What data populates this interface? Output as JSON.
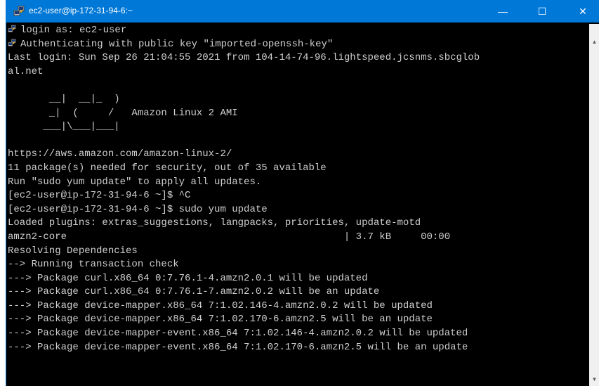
{
  "window": {
    "title": "ec2-user@ip-172-31-94-6:~",
    "minimize_glyph": "—",
    "maximize_glyph": "☐",
    "close_glyph": "✕"
  },
  "icons": {
    "title": "putty-icon",
    "prompt": "putty-icon"
  },
  "colors": {
    "titlebar": "#0078d7",
    "terminal_bg": "#000000",
    "terminal_fg": "#d0d0d0"
  },
  "terminal": {
    "lines": [
      "login as: ec2-user",
      "Authenticating with public key \"imported-openssh-key\"",
      "Last login: Sun Sep 26 21:04:55 2021 from 104-14-74-96.lightspeed.jcsnms.sbcglob",
      "al.net",
      "",
      "       __|  __|_  )",
      "       _|  (     /   Amazon Linux 2 AMI",
      "      ___|\\___|___|",
      "",
      "https://aws.amazon.com/amazon-linux-2/",
      "11 package(s) needed for security, out of 35 available",
      "Run \"sudo yum update\" to apply all updates.",
      "[ec2-user@ip-172-31-94-6 ~]$ ^C",
      "[ec2-user@ip-172-31-94-6 ~]$ sudo yum update",
      "Loaded plugins: extras_suggestions, langpacks, priorities, update-motd",
      "amzn2-core                                               | 3.7 kB     00:00",
      "Resolving Dependencies",
      "--> Running transaction check",
      "---> Package curl.x86_64 0:7.76.1-4.amzn2.0.1 will be updated",
      "---> Package curl.x86_64 0:7.76.1-7.amzn2.0.2 will be an update",
      "---> Package device-mapper.x86_64 7:1.02.146-4.amzn2.0.2 will be updated",
      "---> Package device-mapper.x86_64 7:1.02.170-6.amzn2.5 will be an update",
      "---> Package device-mapper-event.x86_64 7:1.02.146-4.amzn2.0.2 will be updated",
      "---> Package device-mapper-event.x86_64 7:1.02.170-6.amzn2.5 will be an update"
    ]
  }
}
